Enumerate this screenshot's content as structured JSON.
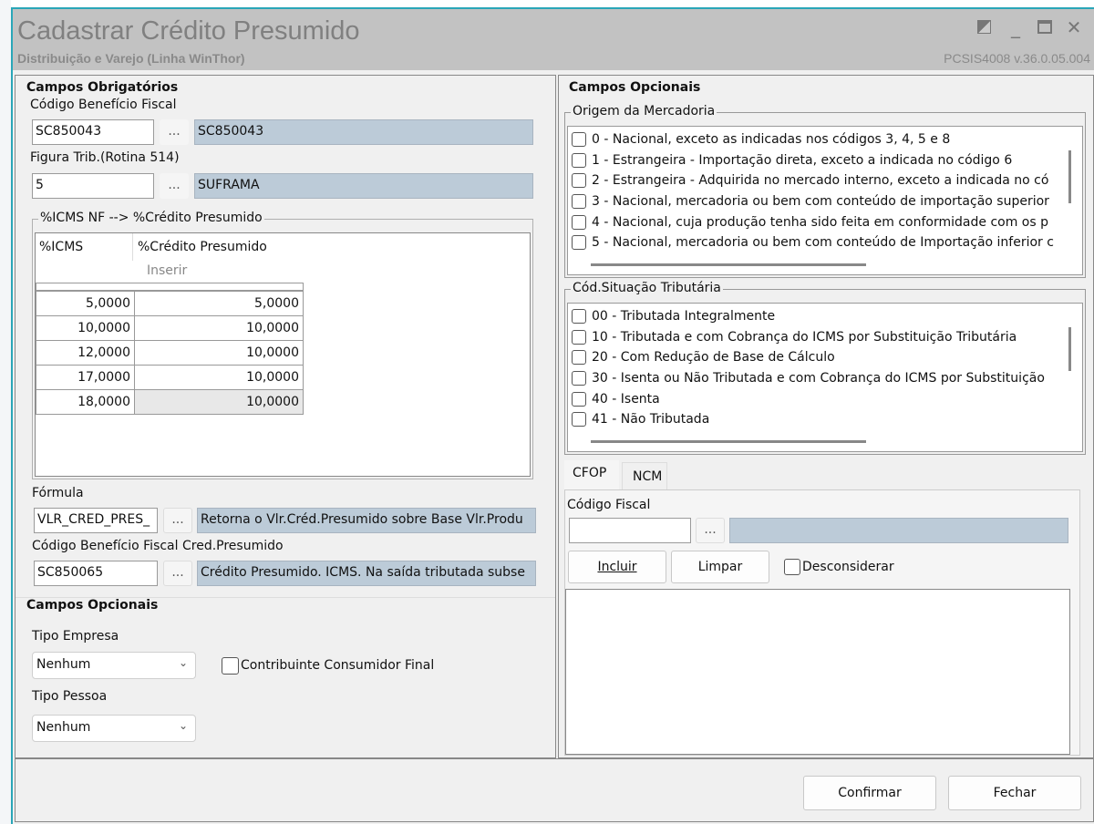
{
  "window": {
    "title": "Cadastrar Crédito Presumido",
    "subtitle": "Distribuição e Varejo (Linha WinThor)",
    "version": "PCSIS4008  v.36.0.05.004",
    "icons": [
      "restore-alt-icon",
      "minimize-icon",
      "maximize-icon",
      "close-icon"
    ],
    "min": "_",
    "max": "☐",
    "close": "✕"
  },
  "left": {
    "title": "Campos Obrigatórios",
    "codigo_beneficio": {
      "label": "Código Benefício Fiscal",
      "value": "SC850043",
      "description": "SC850043"
    },
    "figura_trib": {
      "label": "Figura Trib.(Rotina 514)",
      "value": "5",
      "description": "SUFRAMA"
    },
    "icms_group": {
      "label": "%ICMS NF --> %Crédito Presumido",
      "headers": [
        "%ICMS",
        "%Crédito Presumido"
      ],
      "insert_label": "Inserir",
      "rows": [
        [
          "5,0000",
          "5,0000"
        ],
        [
          "10,0000",
          "10,0000"
        ],
        [
          "12,0000",
          "10,0000"
        ],
        [
          "17,0000",
          "10,0000"
        ],
        [
          "18,0000",
          "10,0000"
        ]
      ]
    },
    "formula": {
      "label": "Fórmula",
      "value": "VLR_CRED_PRES_",
      "description": "Retorna o Vlr.Créd.Presumido sobre Base Vlr.Produ"
    },
    "codigo_cred": {
      "label": "Código Benefício Fiscal Cred.Presumido",
      "value": "SC850065",
      "description": "Crédito Presumido. ICMS. Na saída tributada subse"
    },
    "dots": "...",
    "optional": {
      "title": "Campos Opcionais",
      "tipo_empresa": {
        "label": "Tipo Empresa",
        "value": "Nenhum"
      },
      "contribuinte": "Contribuinte Consumidor Final",
      "tipo_pessoa": {
        "label": "Tipo Pessoa",
        "value": "Nenhum"
      }
    }
  },
  "right": {
    "title": "Campos Opcionais",
    "origem": {
      "label": "Origem da Mercadoria",
      "items": [
        "0 - Nacional, exceto as indicadas nos códigos 3, 4, 5 e 8",
        "1 - Estrangeira - Importação direta, exceto a indicada no código 6",
        "2 - Estrangeira - Adquirida no mercado interno, exceto a indicada no có",
        "3 - Nacional, mercadoria ou bem com conteúdo de importação superior",
        "4 - Nacional, cuja produção tenha sido feita em conformidade com os p",
        "5 - Nacional, mercadoria ou bem com conteúdo de Importação inferior c"
      ]
    },
    "cst": {
      "label": "Cód.Situação Tributária",
      "items": [
        "00 - Tributada Integralmente",
        "10 - Tributada e com Cobrança do ICMS por Substituição Tributária",
        "20 - Com Redução de Base de Cálculo",
        "30 - Isenta ou Não Tributada e com Cobrança do ICMS por Substituição",
        "40 - Isenta",
        "41 - Não Tributada"
      ]
    },
    "tabs": [
      "CFOP",
      "NCM"
    ],
    "codigo_fiscal": {
      "label": "Código Fiscal",
      "value": "",
      "description": ""
    },
    "incluir": "Incluir",
    "limpar": "Limpar",
    "desconsiderar": "Desconsiderar"
  },
  "footer": {
    "confirmar": "Confirmar",
    "fechar": "Fechar"
  }
}
